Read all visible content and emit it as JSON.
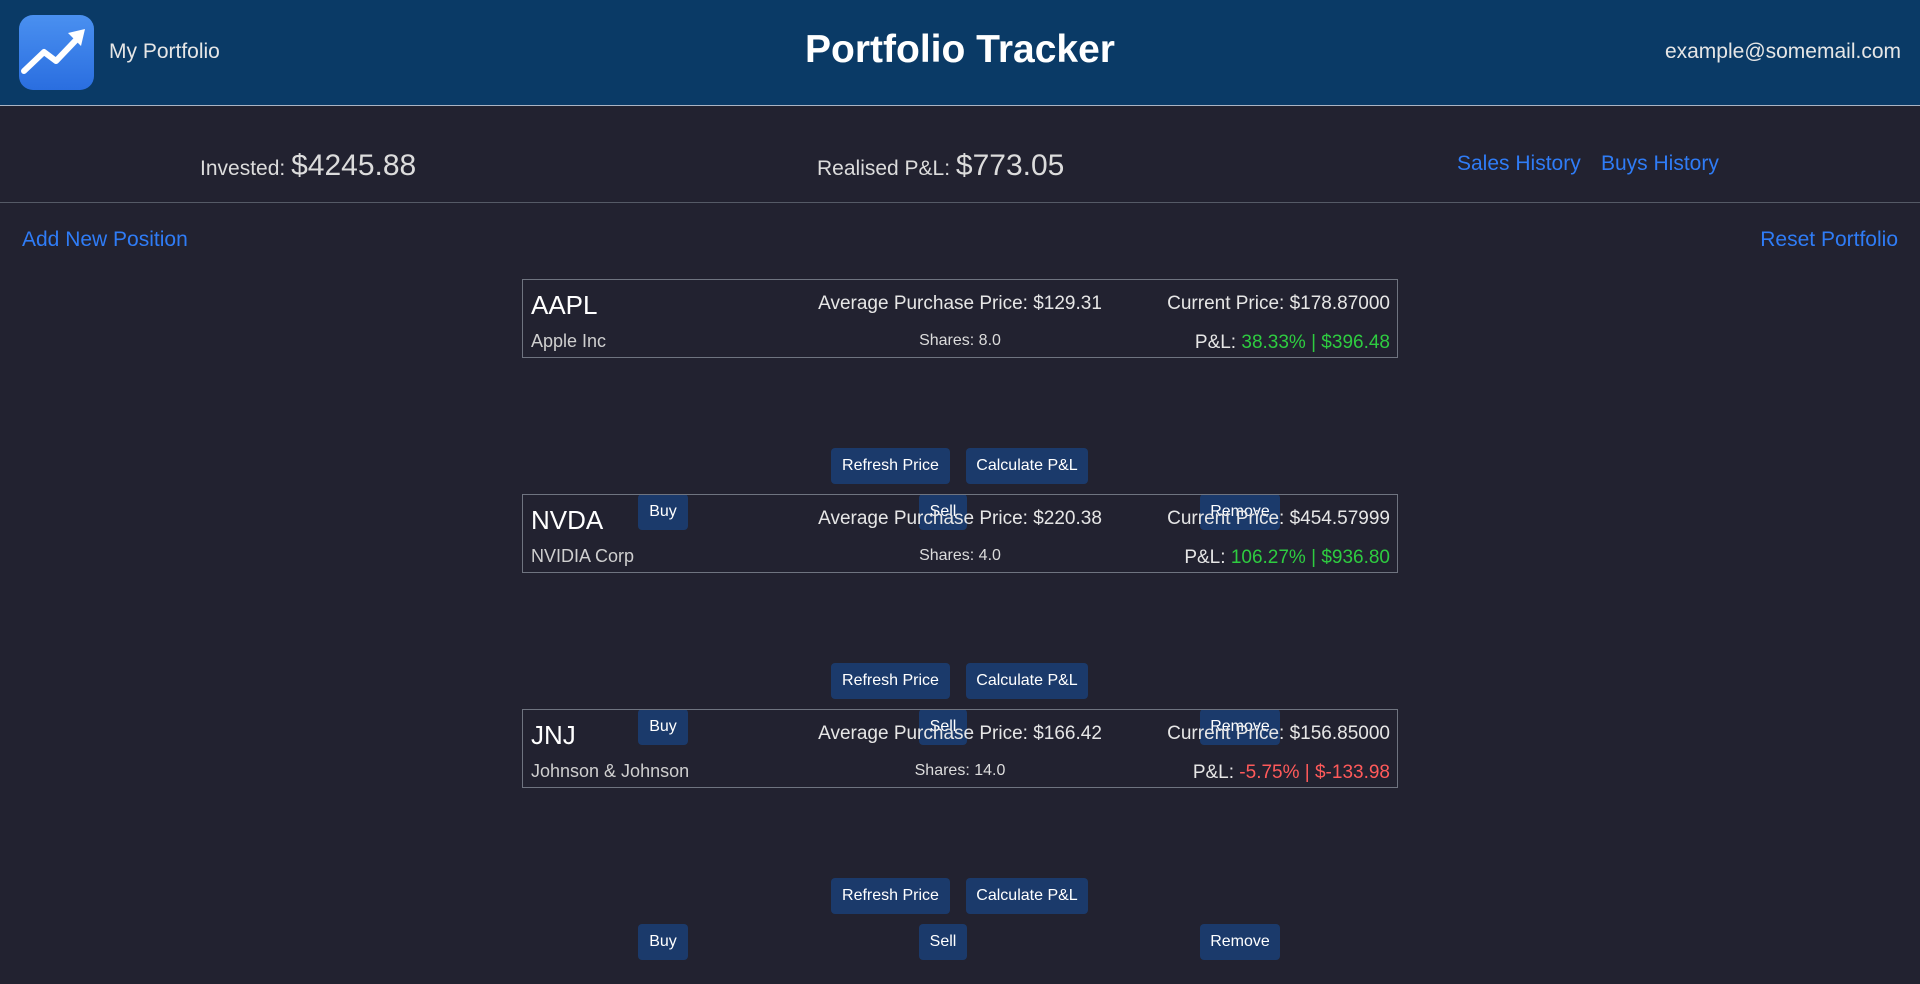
{
  "header": {
    "brand": "My Portfolio",
    "title": "Portfolio Tracker",
    "user_email": "example@somemail.com"
  },
  "summary": {
    "invested_label": "Invested:",
    "invested_value": "$4245.88",
    "realised_label": "Realised P&L:",
    "realised_value": "$773.05",
    "sales_history": "Sales History",
    "buys_history": "Buys History"
  },
  "actions": {
    "add_position": "Add New Position",
    "reset_portfolio": "Reset Portfolio"
  },
  "buttons": {
    "refresh": "Refresh Price",
    "calc": "Calculate P&L",
    "buy": "Buy",
    "sell": "Sell",
    "remove": "Remove"
  },
  "positions": [
    {
      "ticker": "AAPL",
      "company": "Apple Inc",
      "avg_price": "Average Purchase Price: $129.31",
      "shares": "Shares: 8.0",
      "current_price": "Current Price: $178.87000",
      "pnl_label": "P&L:",
      "pnl_value": "38.33% | $396.48",
      "pnl_positive": true
    },
    {
      "ticker": "NVDA",
      "company": "NVIDIA Corp",
      "avg_price": "Average Purchase Price: $220.38",
      "shares": "Shares: 4.0",
      "current_price": "Current Price: $454.57999",
      "pnl_label": "P&L:",
      "pnl_value": "106.27% | $936.80",
      "pnl_positive": true
    },
    {
      "ticker": "JNJ",
      "company": "Johnson & Johnson",
      "avg_price": "Average Purchase Price: $166.42",
      "shares": "Shares: 14.0",
      "current_price": "Current Price: $156.85000",
      "pnl_label": "P&L:",
      "pnl_value": "-5.75% | $-133.98",
      "pnl_positive": false
    }
  ],
  "colors": {
    "header_bg": "#0a3a66",
    "page_bg": "#222230",
    "link": "#2f7cf6",
    "button_bg": "#1b3a6b",
    "gain": "#2ecc40",
    "loss": "#ff5a5a"
  }
}
